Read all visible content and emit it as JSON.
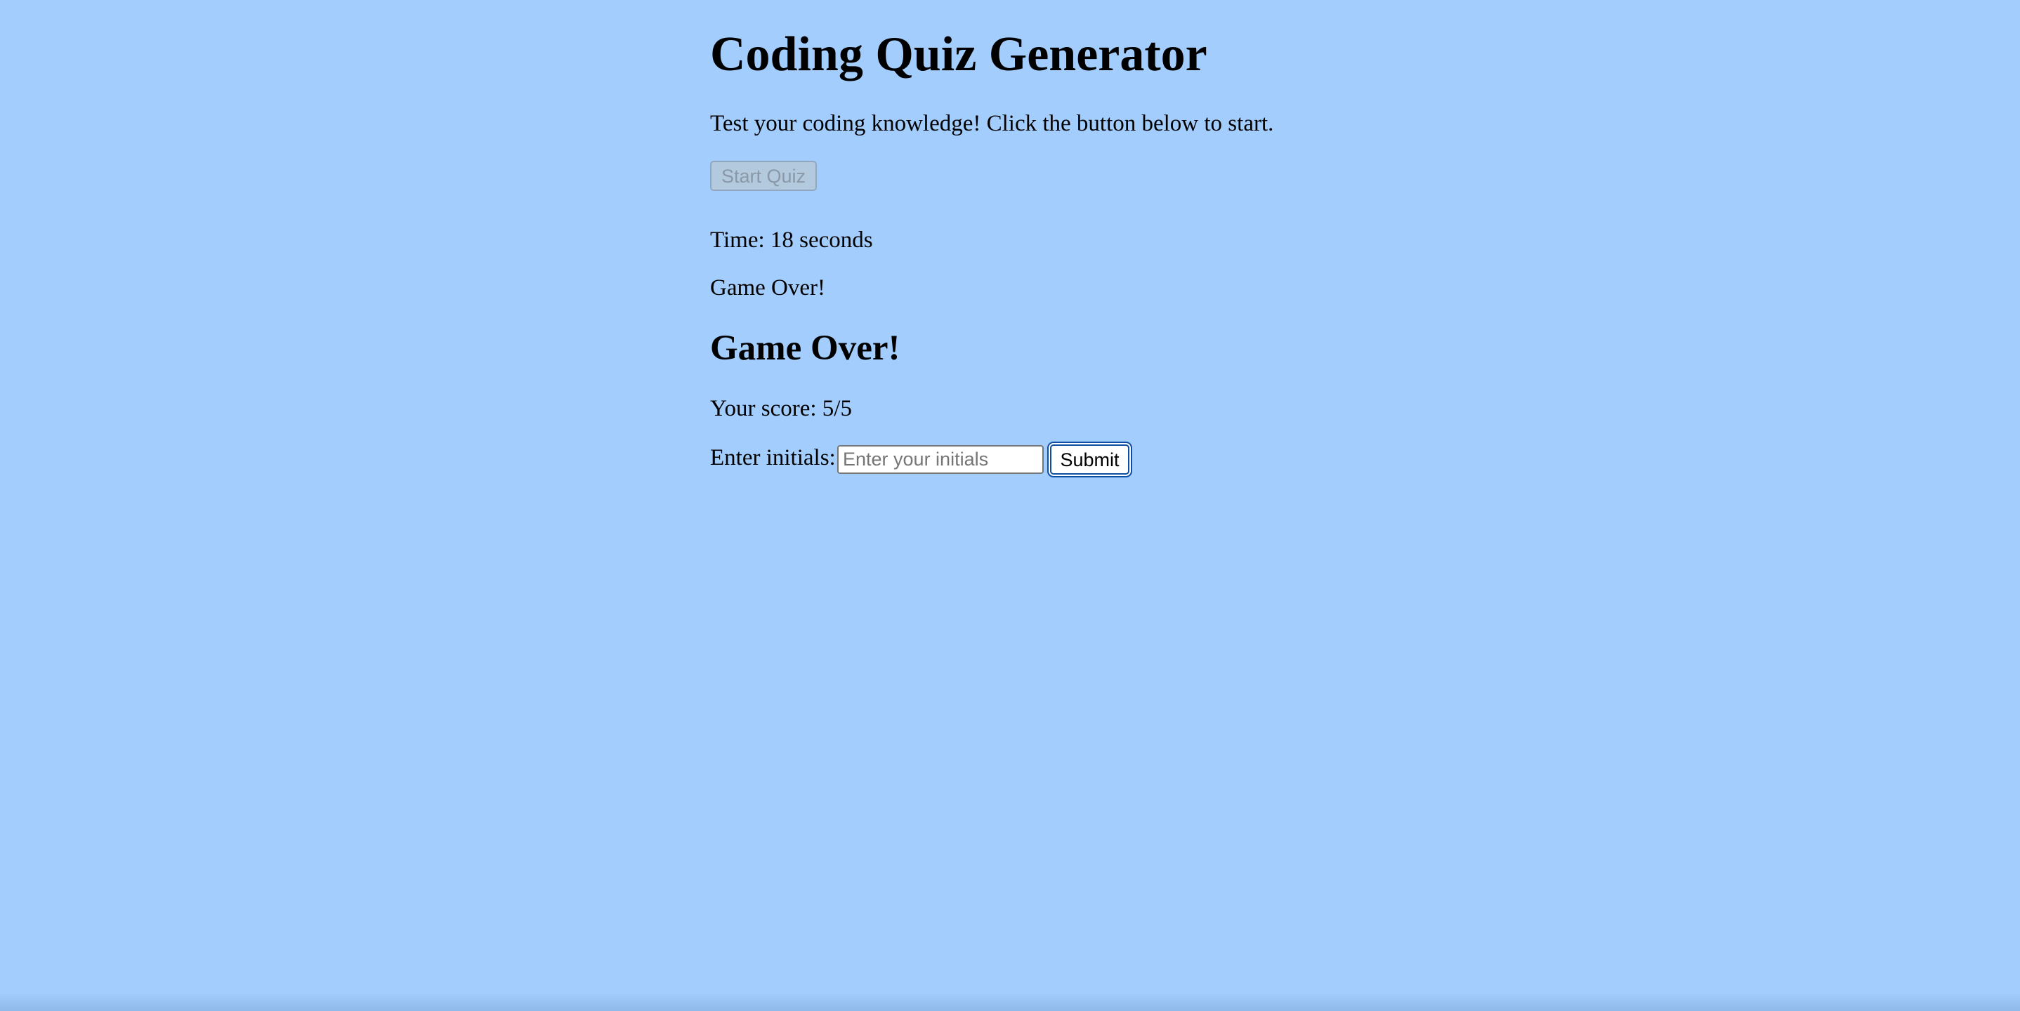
{
  "page": {
    "title": "Coding Quiz Generator",
    "intro": "Test your coding knowledge! Click the button below to start.",
    "start_button_label": "Start Quiz",
    "timer_text": "Time: 18 seconds",
    "status_text": "Game Over!"
  },
  "game_over": {
    "heading": "Game Over!",
    "score_text": "Your score: 5/5",
    "initials_label": "Enter initials:",
    "initials_value": "",
    "initials_placeholder": "Enter your initials",
    "submit_label": "Submit"
  },
  "colors": {
    "background": "#a3cdfd",
    "submit_focus_ring": "#0c4ea3",
    "disabled_button": "#b3c9de"
  }
}
